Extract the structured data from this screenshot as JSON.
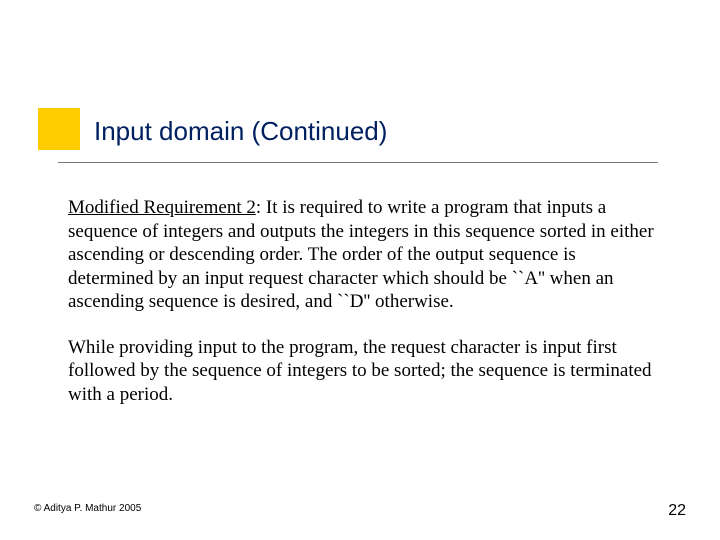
{
  "slide": {
    "title": "Input domain (Continued)",
    "requirement_label": "Modified Requirement 2",
    "paragraph1_rest": ":\nIt is required to write a program that inputs a \nsequence of integers and outputs the integers in this sequence sorted in either ascending or descending order. The order of the output sequence is determined by an input request character which should be ``A'' when an ascending sequence is desired, and ``D'' otherwise.",
    "paragraph2": "While providing input to the program, the request character is input first followed by the sequence of integers to be sorted; the sequence is terminated with a period."
  },
  "footer": {
    "copyright": "© Aditya P. Mathur 2005",
    "page_number": "22"
  }
}
